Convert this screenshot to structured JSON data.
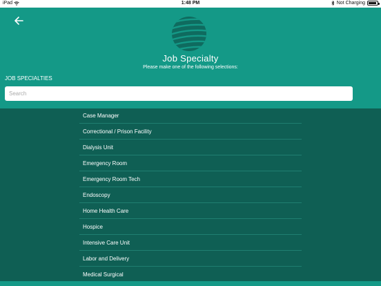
{
  "status_bar": {
    "device": "iPad",
    "time": "1:48 PM",
    "charging": "Not Charging"
  },
  "icons": {
    "back": "arrow-left-icon",
    "logo": "globe-logo",
    "wifi": "wifi-icon",
    "bluetooth": "bluetooth-icon",
    "battery": "battery-icon"
  },
  "header": {
    "title": "Job Specialty",
    "subtitle": "Please make one of the following selections:"
  },
  "section_label": "JOB SPECIALTIES",
  "search": {
    "placeholder": "Search",
    "value": ""
  },
  "specialties": [
    "Case Manager",
    "Correctional / Prison Facility",
    "Dialysis Unit",
    "Emergency Room",
    "Emergency Room Tech",
    "Endoscopy",
    "Home Health Care",
    "Hospice",
    "Intensive Care Unit",
    "Labor and Delivery",
    "Medical Surgical"
  ],
  "colors": {
    "header": "#149987",
    "list_background": "#0f5f54",
    "divider": "#1f7f71",
    "text": "#ffffff"
  }
}
